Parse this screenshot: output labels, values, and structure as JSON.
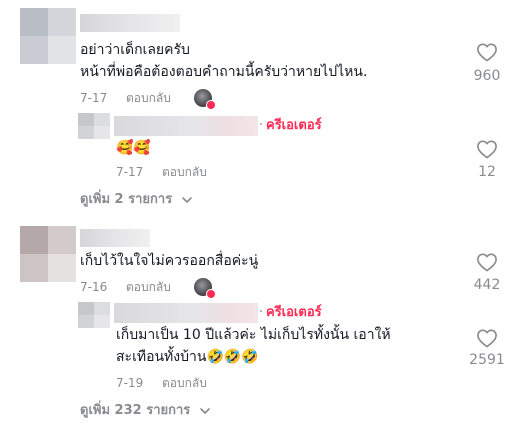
{
  "comments": [
    {
      "line1": "อย่าว่าเด็กเลยครับ",
      "line2": "หน้าที่พ่อคือต้องตอบคำถามนี้ครับว่าหายไปไหน.",
      "date": "7-17",
      "reply_label": "ตอบกลับ",
      "like_count": "960",
      "reply": {
        "creator_label": "ครีเอเตอร์",
        "dot": "·",
        "emoji": "🥰🥰",
        "date": "7-17",
        "reply_label": "ตอบกลับ",
        "like_count": "12"
      },
      "view_more": "ดูเพิ่ม 2 รายการ"
    },
    {
      "line1": "เก็บไว้ในใจไม่ควรออกสื่อค่ะนู่",
      "date": "7-16",
      "reply_label": "ตอบกลับ",
      "like_count": "442",
      "reply": {
        "creator_label": "ครีเอเตอร์",
        "dot": "·",
        "line1": "เก็บมาเป็น 10 ปีแล้วค่ะ ไม่เก็บไรทั้งนั้น เอาให้",
        "line2": "สะเทือนทั้งบ้าน🤣🤣🤣",
        "date": "7-19",
        "reply_label": "ตอบกลับ",
        "like_count": "2591"
      },
      "view_more": "ดูเพิ่ม 232 รายการ"
    }
  ],
  "icons": {
    "like": "heart-outline-icon",
    "expand": "chevron-down-icon",
    "creator": "creator-liked-badge"
  },
  "colors": {
    "creator_red": "#fe2c55",
    "meta_gray": "#8a8b91"
  }
}
